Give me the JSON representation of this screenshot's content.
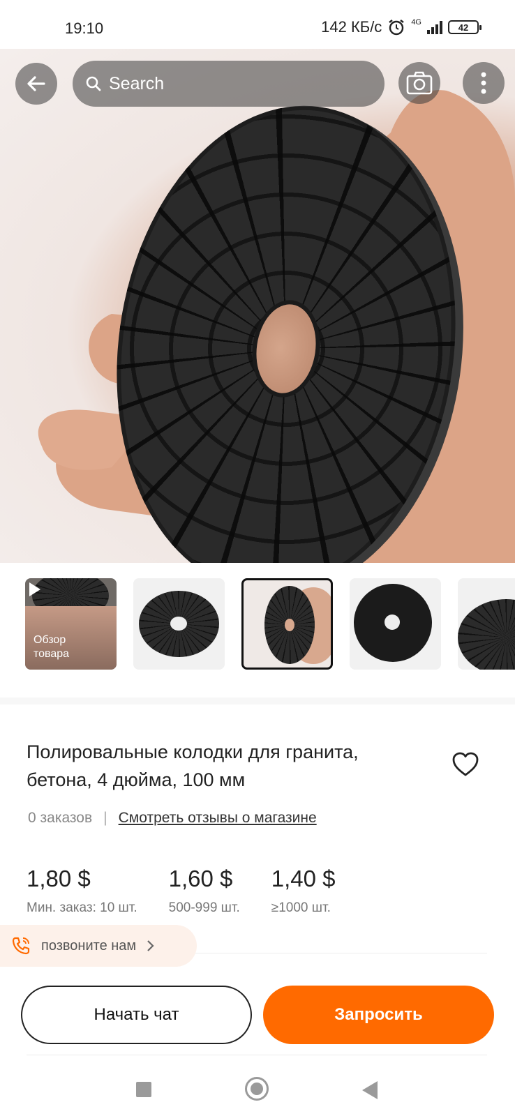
{
  "status_bar": {
    "time": "19:10",
    "net_speed": "142 КБ/с",
    "network": "4G",
    "battery": "42"
  },
  "search": {
    "placeholder": "Search"
  },
  "thumbnails": [
    {
      "label": "Обзор товара",
      "is_video": true
    },
    {
      "label": "",
      "is_video": false
    },
    {
      "label": "",
      "is_video": false,
      "selected": true
    },
    {
      "label": "",
      "is_video": false
    },
    {
      "label": "",
      "is_video": false
    }
  ],
  "product": {
    "title": "Полировальные колодки для гранита, бетона, 4 дюйма, 100 мм",
    "orders": "0 заказов",
    "reviews_link": "Смотреть отзывы о магазине"
  },
  "prices": [
    {
      "value": "1,80 $",
      "qty": "Мин. заказ: 10 шт."
    },
    {
      "value": "1,60 $",
      "qty": "500-999 шт."
    },
    {
      "value": "1,40 $",
      "qty": "≥1000 шт."
    }
  ],
  "call": {
    "label": "позвоните нам"
  },
  "actions": {
    "chat": "Начать чат",
    "request": "Запросить"
  },
  "colors": {
    "accent": "#ff6a00"
  }
}
